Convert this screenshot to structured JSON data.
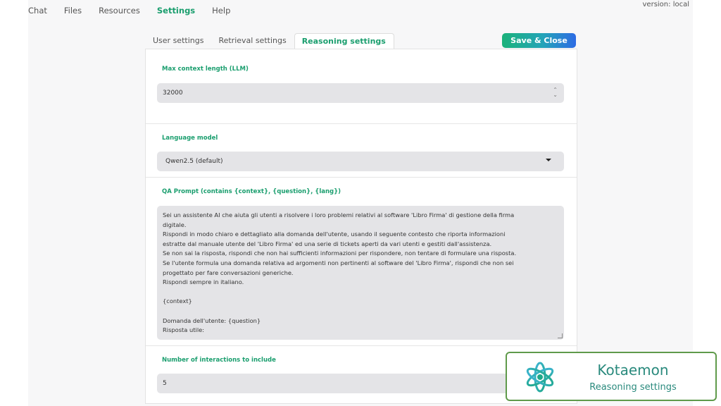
{
  "nav": {
    "items": [
      {
        "label": "Chat"
      },
      {
        "label": "Files"
      },
      {
        "label": "Resources"
      },
      {
        "label": "Settings",
        "active": true
      },
      {
        "label": "Help"
      }
    ]
  },
  "version": "version: local",
  "tabs": [
    {
      "label": "User settings"
    },
    {
      "label": "Retrieval settings"
    },
    {
      "label": "Reasoning settings",
      "active": true
    }
  ],
  "save_button": "Save & Close",
  "sections": {
    "max_context": {
      "label": "Max context length (LLM)",
      "value": "32000"
    },
    "language_model": {
      "label": "Language model",
      "value": "Qwen2.5 (default)"
    },
    "qa_prompt": {
      "label": "QA Prompt (contains {context}, {question}, {lang})",
      "value": "Sei un assistente AI che aiuta gli utenti a risolvere i loro problemi relativi al software 'Libro Firma' di gestione della firma\ndigitale.\nRispondi in modo chiaro e dettagliato alla domanda dell'utente, usando il seguente contesto che riporta informazioni\nestratte dal manuale utente del 'Libro Firma' ed una serie di tickets aperti da vari utenti e gestiti dall'assistenza.\nSe non sai la risposta, rispondi che non hai sufficienti informazioni per rispondere, non tentare di formulare una risposta.\nSe l'utente formula una domanda relativa ad argomenti non pertinenti al software del 'Libro Firma', rispondi che non sei\nprogettato per fare conversazioni generiche.\nRispondi sempre in italiano.\n\n{context}\n\nDomanda dell'utente: {question}\nRisposta utile:"
    },
    "interactions": {
      "label": "Number of interactions to include",
      "value": "5"
    }
  },
  "badge": {
    "title": "Kotaemon",
    "subtitle": "Reasoning settings"
  },
  "colors": {
    "accent": "#1a9e6e",
    "badge_border": "#5f9a4b",
    "badge_text": "#2a8a7d"
  }
}
